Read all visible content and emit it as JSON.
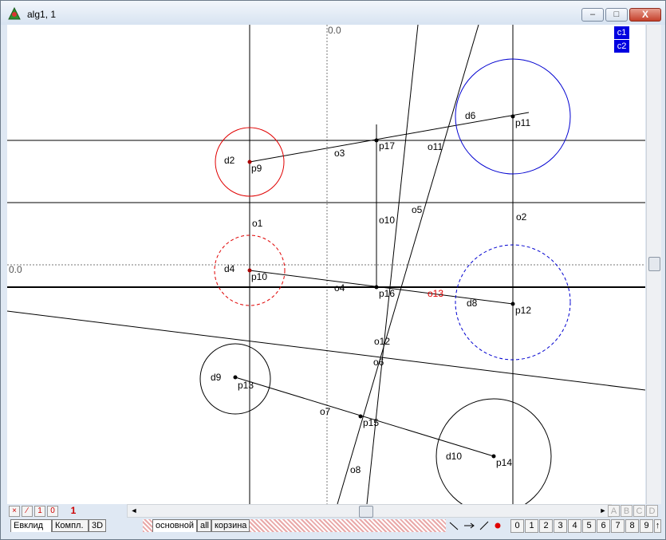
{
  "window": {
    "title": "alg1, 1",
    "min_label": "–",
    "max_label": "□",
    "close_label": "X"
  },
  "canvas": {
    "axis_label_top": "0.0",
    "axis_label_left": "0.0"
  },
  "legend": [
    "c1",
    "c2"
  ],
  "labels": {
    "p9": "p9",
    "p10": "p10",
    "p11": "p11",
    "p12": "p12",
    "p13": "p13",
    "p14": "p14",
    "p15": "p15",
    "p16": "p16",
    "p17": "p17",
    "d2": "d2",
    "d4": "d4",
    "d6": "d6",
    "d8": "d8",
    "d9": "d9",
    "d10": "d10",
    "o1": "o1",
    "o2": "o2",
    "o3": "o3",
    "o4": "o4",
    "o5": "o5",
    "o7": "o7",
    "o8": "o8",
    "o10": "o10",
    "o11": "o11",
    "o12": "o12",
    "o13": "o13",
    "o6": "o6"
  },
  "toolbar": {
    "tools": [
      "×",
      "∕",
      "1",
      "0"
    ],
    "counter": "1",
    "scroll_left": "◄",
    "scroll_right": "►",
    "abcd": [
      "A",
      "B",
      "C",
      "D"
    ]
  },
  "tabs": {
    "left": [
      "Евклид",
      "Компл.",
      "3D"
    ],
    "right": [
      "основной",
      "all",
      "корзина"
    ]
  },
  "numbers": [
    "0",
    "1",
    "2",
    "3",
    "4",
    "5",
    "6",
    "7",
    "8",
    "9",
    "↑"
  ],
  "colors": {
    "accent_blue": "#0000e0",
    "red": "#e00000",
    "circle_blue": "#0000d0"
  }
}
